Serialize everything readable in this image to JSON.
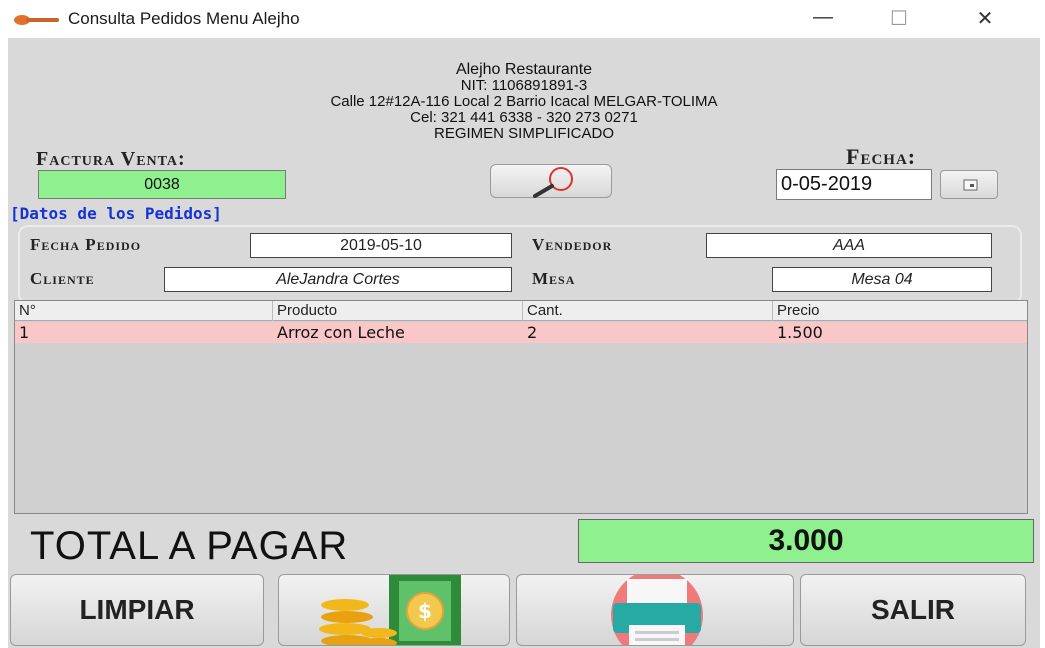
{
  "window": {
    "title": "Consulta Pedidos Menu Alejho",
    "minimize_glyph": "—",
    "maximize_glyph": "☐",
    "close_glyph": "✕"
  },
  "header": {
    "business_name": "Alejho Restaurante",
    "nit": "NIT: 1106891891-3",
    "address": "Calle 12#12A-116 Local 2 Barrio Icacal MELGAR-TOLIMA",
    "phone": "Cel: 321 441  6338 - 320 273 0271",
    "regime": "REGIMEN SIMPLIFICADO"
  },
  "invoice": {
    "label": "Factura Venta:",
    "number": "0038",
    "date_label": "Fecha:",
    "date_value": "0-05-2019"
  },
  "section_label": "[Datos de los Pedidos]",
  "order": {
    "fecha_pedido_label": "Fecha Pedido",
    "fecha_pedido_value": "2019-05-10",
    "vendedor_label": "Vendedor",
    "vendedor_value": "AAA",
    "cliente_label": "Cliente",
    "cliente_value": "AleJandra Cortes",
    "mesa_label": "Mesa",
    "mesa_value": "Mesa 04"
  },
  "table": {
    "columns": [
      "N°",
      "Producto",
      "Cant.",
      "Precio"
    ],
    "rows": [
      [
        "1",
        "Arroz con Leche",
        "2",
        "1.500"
      ]
    ]
  },
  "total": {
    "label": "TOTAL A PAGAR",
    "value": "3.000"
  },
  "buttons": {
    "limpiar": "LIMPIAR",
    "salir": "SALIR"
  },
  "icons": {
    "app": "spoon-icon",
    "search": "magnifier-icon",
    "calendar": "calendar-icon",
    "pay": "coins-money-icon",
    "print": "printer-icon"
  },
  "colors": {
    "field_green": "#8ef08e",
    "selected_row": "#f9c7c7",
    "section_blue": "#1532d4",
    "window_bg": "#d9d9d9"
  }
}
